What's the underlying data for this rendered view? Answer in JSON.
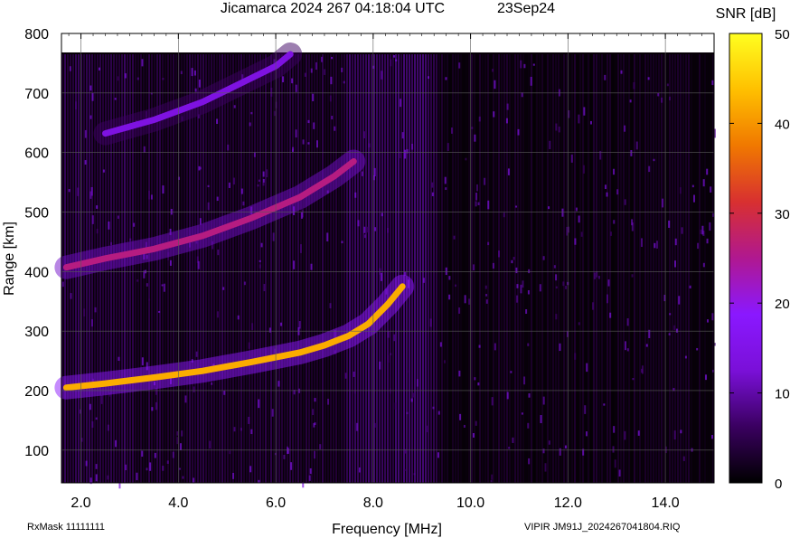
{
  "chart_data": {
    "type": "heatmap",
    "title": "Jicamarca 2024 267 04:18:04 UTC",
    "date_label": "23Sep24",
    "xlabel": "Frequency [MHz]",
    "ylabel": "Range [km]",
    "xlim": [
      1.6,
      15.0
    ],
    "ylim": [
      45,
      800
    ],
    "x_ticks": [
      "2.0",
      "4.0",
      "6.0",
      "8.0",
      "10.0",
      "12.0",
      "14.0"
    ],
    "x_tick_values": [
      2.0,
      4.0,
      6.0,
      8.0,
      10.0,
      12.0,
      14.0
    ],
    "y_ticks": [
      "100",
      "200",
      "300",
      "400",
      "500",
      "600",
      "700",
      "800"
    ],
    "y_tick_values": [
      100,
      200,
      300,
      400,
      500,
      600,
      700,
      800
    ],
    "data_ceiling_km": 765,
    "colorbar": {
      "label": "SNR [dB]",
      "range": [
        0,
        50
      ],
      "ticks": [
        "0",
        "10",
        "20",
        "30",
        "40",
        "50"
      ],
      "tick_values": [
        0,
        10,
        20,
        30,
        40,
        50
      ],
      "colormap": [
        "#000000",
        "#3a0060",
        "#7a10d8",
        "#8a18ff",
        "#b01890",
        "#d83030",
        "#f07800",
        "#ffc000",
        "#ffff20"
      ]
    },
    "grid": true,
    "traces": [
      {
        "points": [
          [
            1.7,
            205
          ],
          [
            2.5,
            212
          ],
          [
            3.5,
            222
          ],
          [
            4.5,
            233
          ],
          [
            5.5,
            248
          ],
          [
            6.5,
            264
          ],
          [
            7.0,
            276
          ],
          [
            7.5,
            292
          ],
          [
            7.9,
            312
          ],
          [
            8.3,
            345
          ],
          [
            8.6,
            375
          ]
        ],
        "snr": 42
      },
      {
        "points": [
          [
            1.7,
            407
          ],
          [
            2.5,
            422
          ],
          [
            3.5,
            438
          ],
          [
            4.5,
            460
          ],
          [
            5.5,
            490
          ],
          [
            6.5,
            525
          ],
          [
            7.2,
            560
          ],
          [
            7.6,
            585
          ]
        ],
        "snr": 26
      },
      {
        "points": [
          [
            2.5,
            632
          ],
          [
            3.5,
            655
          ],
          [
            4.5,
            685
          ],
          [
            5.5,
            725
          ],
          [
            6.0,
            745
          ],
          [
            6.3,
            765
          ]
        ],
        "snr": 14
      }
    ]
  },
  "footer": {
    "rxmask": "RxMask 11111111",
    "file": "VIPIR  JM91J_2024267041804.RIQ"
  }
}
